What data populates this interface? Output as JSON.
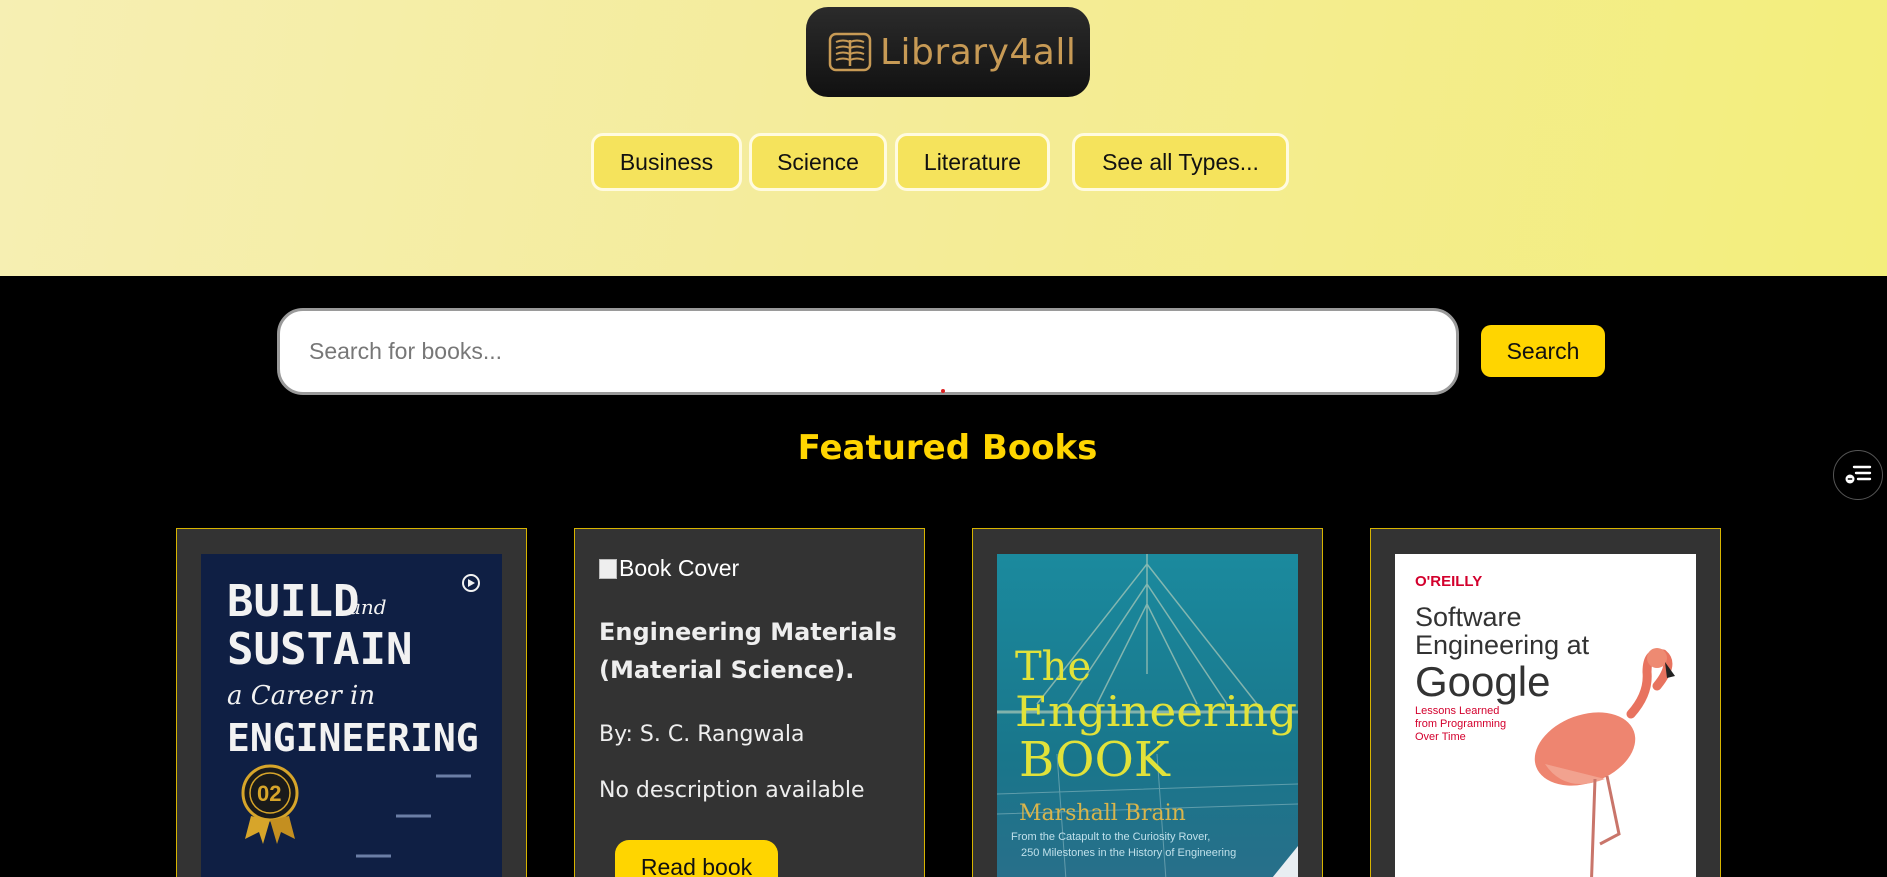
{
  "header": {
    "logo_text": "Library4all",
    "nav": [
      {
        "label": "Business"
      },
      {
        "label": "Science"
      },
      {
        "label": "Literature"
      },
      {
        "label": "See all Types..."
      }
    ]
  },
  "search": {
    "placeholder": "Search for books...",
    "value": "",
    "button_label": "Search"
  },
  "featured": {
    "title": "Featured Books",
    "books": [
      {
        "cover": {
          "line1": "BUILD",
          "line1_small": "and",
          "line2": "SUSTAIN",
          "line3": "a Career in",
          "line4": "ENGINEERING",
          "badge": "02"
        }
      },
      {
        "cover_alt": "Book Cover",
        "title": "Engineering Materials (Material Science).",
        "author": "By: S. C. Rangwala",
        "description": "No description available",
        "read_label": "Read book"
      },
      {
        "cover": {
          "line1": "The",
          "line2": "Engineering",
          "line3": "BOOK",
          "author": "Marshall Brain",
          "subtitle1": "From the Catapult to the Curiosity Rover,",
          "subtitle2": "250 Milestones in the History of Engineering"
        }
      },
      {
        "cover": {
          "publisher": "O'REILLY",
          "line1": "Software",
          "line2": "Engineering at",
          "line3": "Google",
          "tag1": "Lessons Learned",
          "tag2": "from Programming",
          "tag3": "Over Time"
        }
      }
    ]
  },
  "colors": {
    "accent": "#ffd500",
    "header_bg": "#f4ec9a",
    "card_bg": "#333333",
    "page_bg": "#000000"
  },
  "icons": [
    "book-logo-icon",
    "sidebar-toggle-icon",
    "broken-image-icon"
  ]
}
